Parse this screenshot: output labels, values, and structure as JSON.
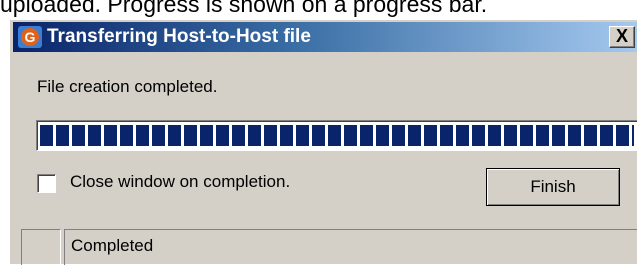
{
  "caption": "uploaded. Progress is shown on a progress bar.",
  "window": {
    "title": "Transferring Host-to-Host file",
    "app_icon": "g-app-icon",
    "close_label": "X"
  },
  "message": "File creation completed.",
  "progress": {
    "percent": 100,
    "fill_color": "#0a246a"
  },
  "close_on_completion": {
    "label": "Close window on completion.",
    "checked": false
  },
  "finish_button": {
    "label": "Finish"
  },
  "statusbar": {
    "text": "Completed"
  }
}
